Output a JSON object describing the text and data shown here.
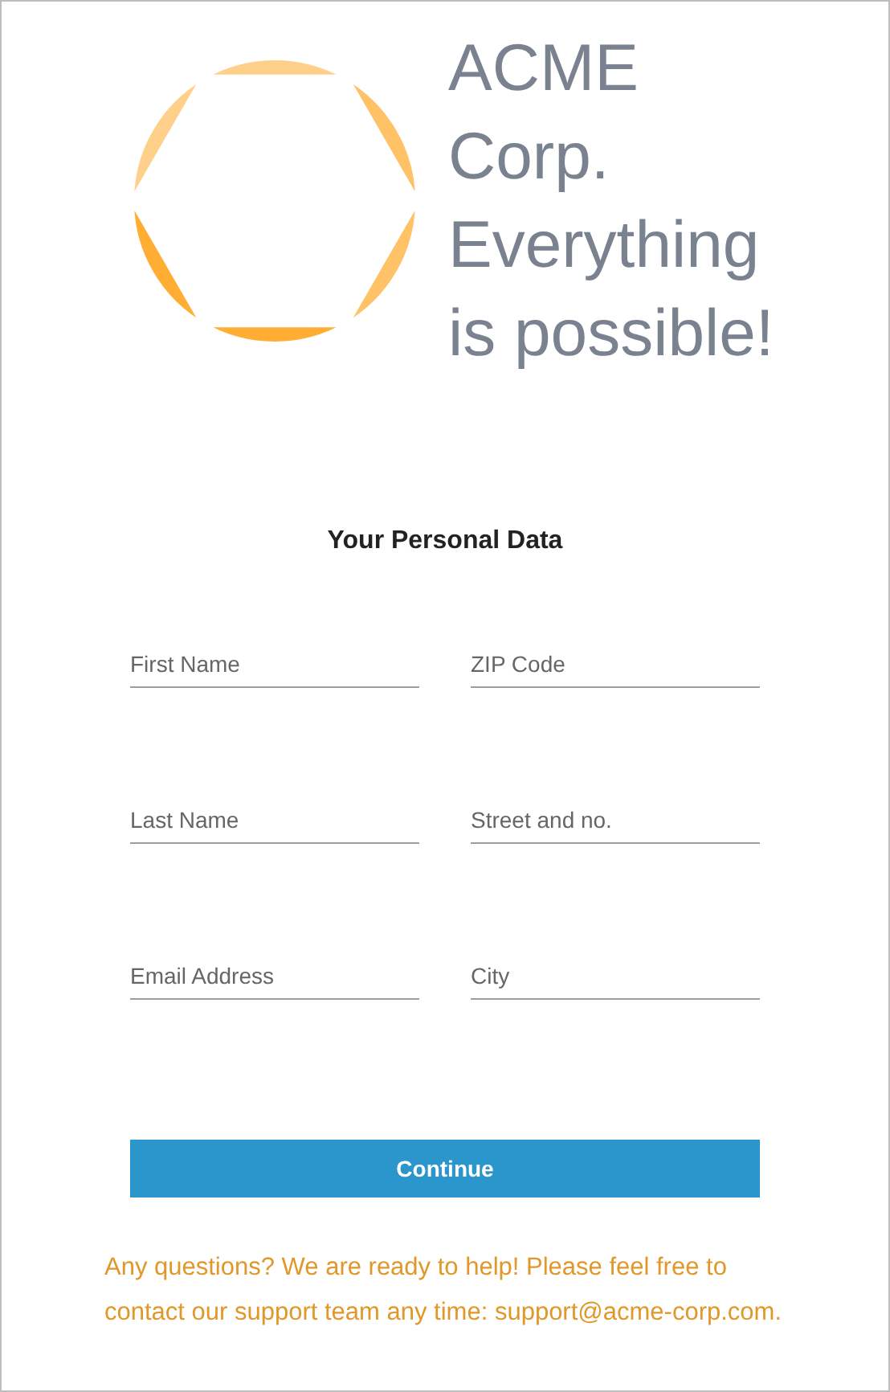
{
  "brand": {
    "lines": [
      "ACME",
      "Corp.",
      "Everything",
      "is possible!"
    ]
  },
  "form": {
    "title": "Your Personal Data",
    "fields": [
      {
        "placeholder": "First Name"
      },
      {
        "placeholder": "ZIP Code"
      },
      {
        "placeholder": "Last Name"
      },
      {
        "placeholder": "Street and no."
      },
      {
        "placeholder": "Email Address"
      },
      {
        "placeholder": "City"
      }
    ],
    "submit": "Continue"
  },
  "footer": {
    "text": "Any questions? We are ready to help! Please feel free to contact our support team any time: support@acme-corp.com."
  }
}
